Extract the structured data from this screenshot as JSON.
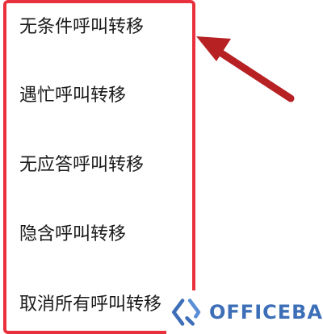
{
  "menu": {
    "items": [
      {
        "label": "无条件呼叫转移"
      },
      {
        "label": "遇忙呼叫转移"
      },
      {
        "label": "无应答呼叫转移"
      },
      {
        "label": "隐含呼叫转移"
      },
      {
        "label": "取消所有呼叫转移"
      }
    ]
  },
  "watermark": {
    "text": "OFFICEBA"
  },
  "colors": {
    "highlight": "#e8313d",
    "arrow": "#b72124",
    "watermark": "#3d6fb8",
    "text": "#1a1a1a"
  }
}
